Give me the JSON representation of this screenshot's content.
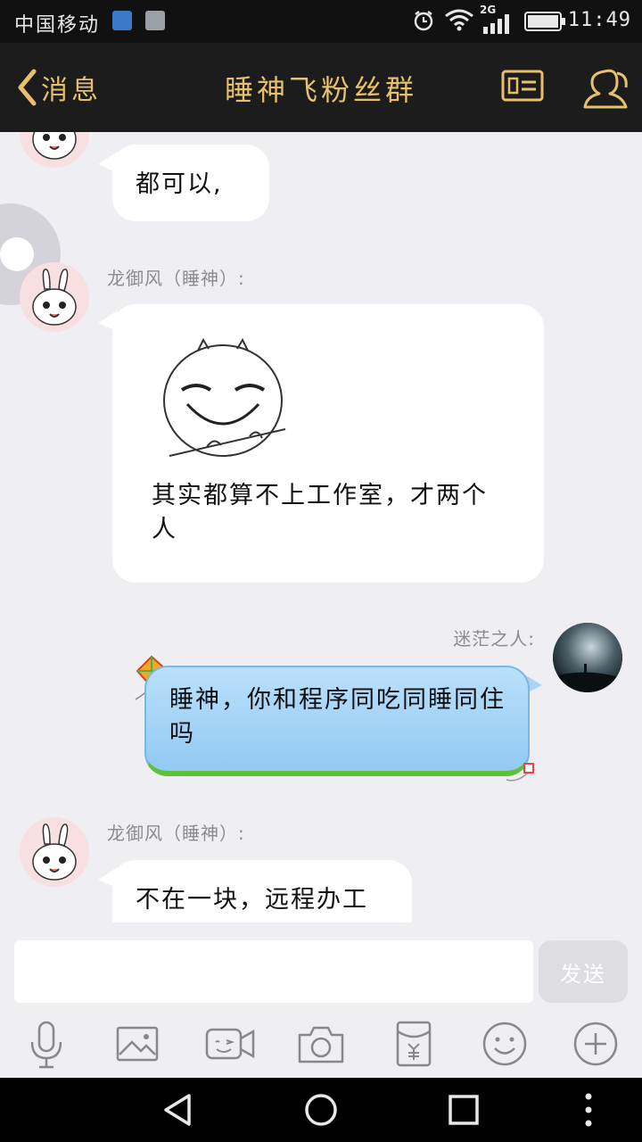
{
  "status_bar": {
    "carrier": "中国移动",
    "network": "2G",
    "time": "11:49"
  },
  "header": {
    "back_label": "消息",
    "title": "睡神飞粉丝群",
    "accent_color": "#e6c06a"
  },
  "messages": [
    {
      "sender": "",
      "text": "都可以,",
      "side": "left"
    },
    {
      "sender": "龙御风（睡神）:",
      "text": "其实都算不上工作室，才两个人",
      "side": "left",
      "has_sticker": true
    },
    {
      "sender": "迷茫之人:",
      "text": "睡神，你和程序同吃同睡同住吗",
      "side": "right"
    },
    {
      "sender": "龙御风（睡神）:",
      "text": "不在一块，远程办工",
      "side": "left"
    }
  ],
  "input": {
    "placeholder": "",
    "send_label": "发送"
  },
  "toolbar": {
    "icons": [
      "microphone-icon",
      "image-icon",
      "video-call-icon",
      "camera-icon",
      "red-packet-icon",
      "emoji-icon",
      "plus-icon"
    ]
  },
  "nav": {
    "icons": [
      "back-icon",
      "home-icon",
      "recents-icon",
      "more-icon"
    ]
  }
}
